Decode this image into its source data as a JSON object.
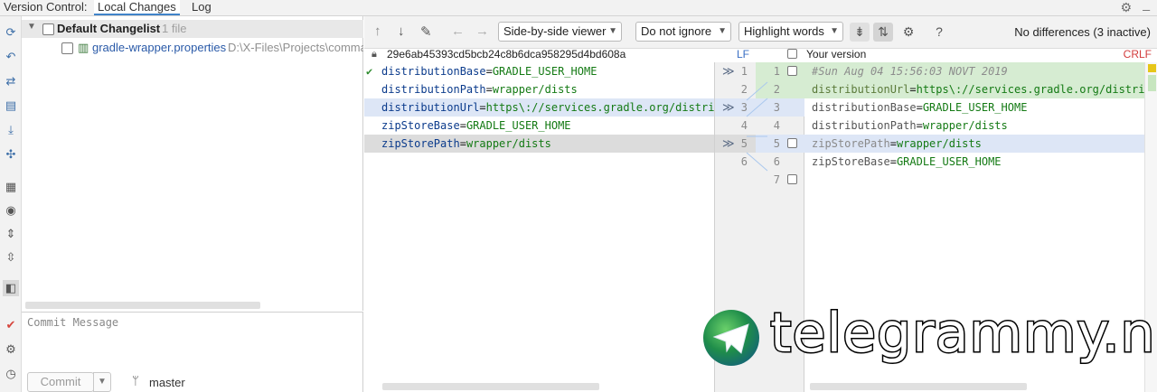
{
  "tabs": {
    "prefix": "Version Control:",
    "local": "Local Changes",
    "log": "Log"
  },
  "changelist": {
    "name": "Default Changelist",
    "count": "1 file"
  },
  "file": {
    "name": "gradle-wrapper.properties",
    "path": "D:\\X-Files\\Projects\\command"
  },
  "commit": {
    "placeholder": "Commit Message",
    "button": "Commit",
    "branch": "master"
  },
  "diff_toolbar": {
    "viewer": "Side-by-side viewer",
    "ignore": "Do not ignore",
    "highlight": "Highlight words",
    "status": "No differences (3 inactive)"
  },
  "diff_header": {
    "left_revision": "29e6ab45393cd5bcb24c8b6dca958295d4bd608a",
    "left_sep": "LF",
    "right_label": "Your version",
    "right_sep": "CRLF"
  },
  "left_lines": [
    {
      "key": "distributionBase",
      "val": "GRADLE_USER_HOME"
    },
    {
      "key": "distributionPath",
      "val": "wrapper/dists"
    },
    {
      "key": "distributionUrl",
      "val": "https\\://services.gradle.org/distribu"
    },
    {
      "key": "zipStoreBase",
      "val": "GRADLE_USER_HOME"
    },
    {
      "key": "zipStorePath",
      "val": "wrapper/dists"
    }
  ],
  "left_numbers": [
    "1",
    "2",
    "3",
    "4",
    "5",
    "6"
  ],
  "right_numbers": [
    "1",
    "2",
    "3",
    "4",
    "5",
    "6",
    "7"
  ],
  "right_lines": [
    {
      "comment": "#Sun Aug 04 15:56:03 NOVT 2019"
    },
    {
      "key": "distributionUrl",
      "val": "https\\://services.gradle.org/distribu"
    },
    {
      "key": "distributionBase",
      "val": "GRADLE_USER_HOME"
    },
    {
      "key": "distributionPath",
      "val": "wrapper/dists"
    },
    {
      "key": "zipStorePath",
      "val": "wrapper/dists"
    },
    {
      "key": "zipStoreBase",
      "val": "GRADLE_USER_HOME"
    }
  ],
  "watermark": "telegrammy.net",
  "colors": {
    "added": "#d6ecd2",
    "moved": "#dde6f6",
    "selected": "#dcdcdc",
    "accent": "#4083c9"
  }
}
